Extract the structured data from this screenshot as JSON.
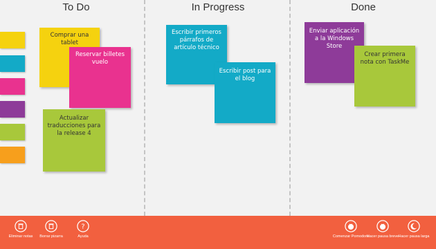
{
  "columns": [
    {
      "title": "To Do"
    },
    {
      "title": "In Progress"
    },
    {
      "title": "Done"
    }
  ],
  "swatches": [
    "#f5d20f",
    "#13aac7",
    "#e9328f",
    "#8e3b99",
    "#a8c83b",
    "#f79f1c"
  ],
  "notes": {
    "tablet": {
      "text": "Comprar una tablet",
      "color": "#f5d20f"
    },
    "billetes": {
      "text": "Reservar billetes vuelo",
      "color": "#e9328f"
    },
    "traducciones": {
      "text": "Actualizar traducciones para la release 4",
      "color": "#a8c83b"
    },
    "parrafos": {
      "text": "Escribir primeros párrafos de artículo técnico",
      "color": "#13aac7"
    },
    "post": {
      "text": "Escribir post para el blog",
      "color": "#13aac7"
    },
    "windows_store": {
      "text": "Enviar aplicación a la Windows Store",
      "color": "#8e3b99"
    },
    "taskme": {
      "text": "Crear primera nota con TaskMe",
      "color": "#a8c83b"
    }
  },
  "toolbar": {
    "color": "#f2603f",
    "eliminar": {
      "label": "Eliminar notas",
      "icon": "trash-icon"
    },
    "borrar": {
      "label": "Borrar pizarra",
      "icon": "trash-icon"
    },
    "ayuda": {
      "label": "Ayuda",
      "icon": "help-icon"
    },
    "pomodoro": {
      "label": "Comenzar Pomodoro",
      "icon": "tomato-icon"
    },
    "pausa_breve": {
      "label": "Hacer pausa breve",
      "icon": "tomato-icon"
    },
    "pausa_larga": {
      "label": "Hacer pausa larga",
      "icon": "moon-icon"
    }
  }
}
